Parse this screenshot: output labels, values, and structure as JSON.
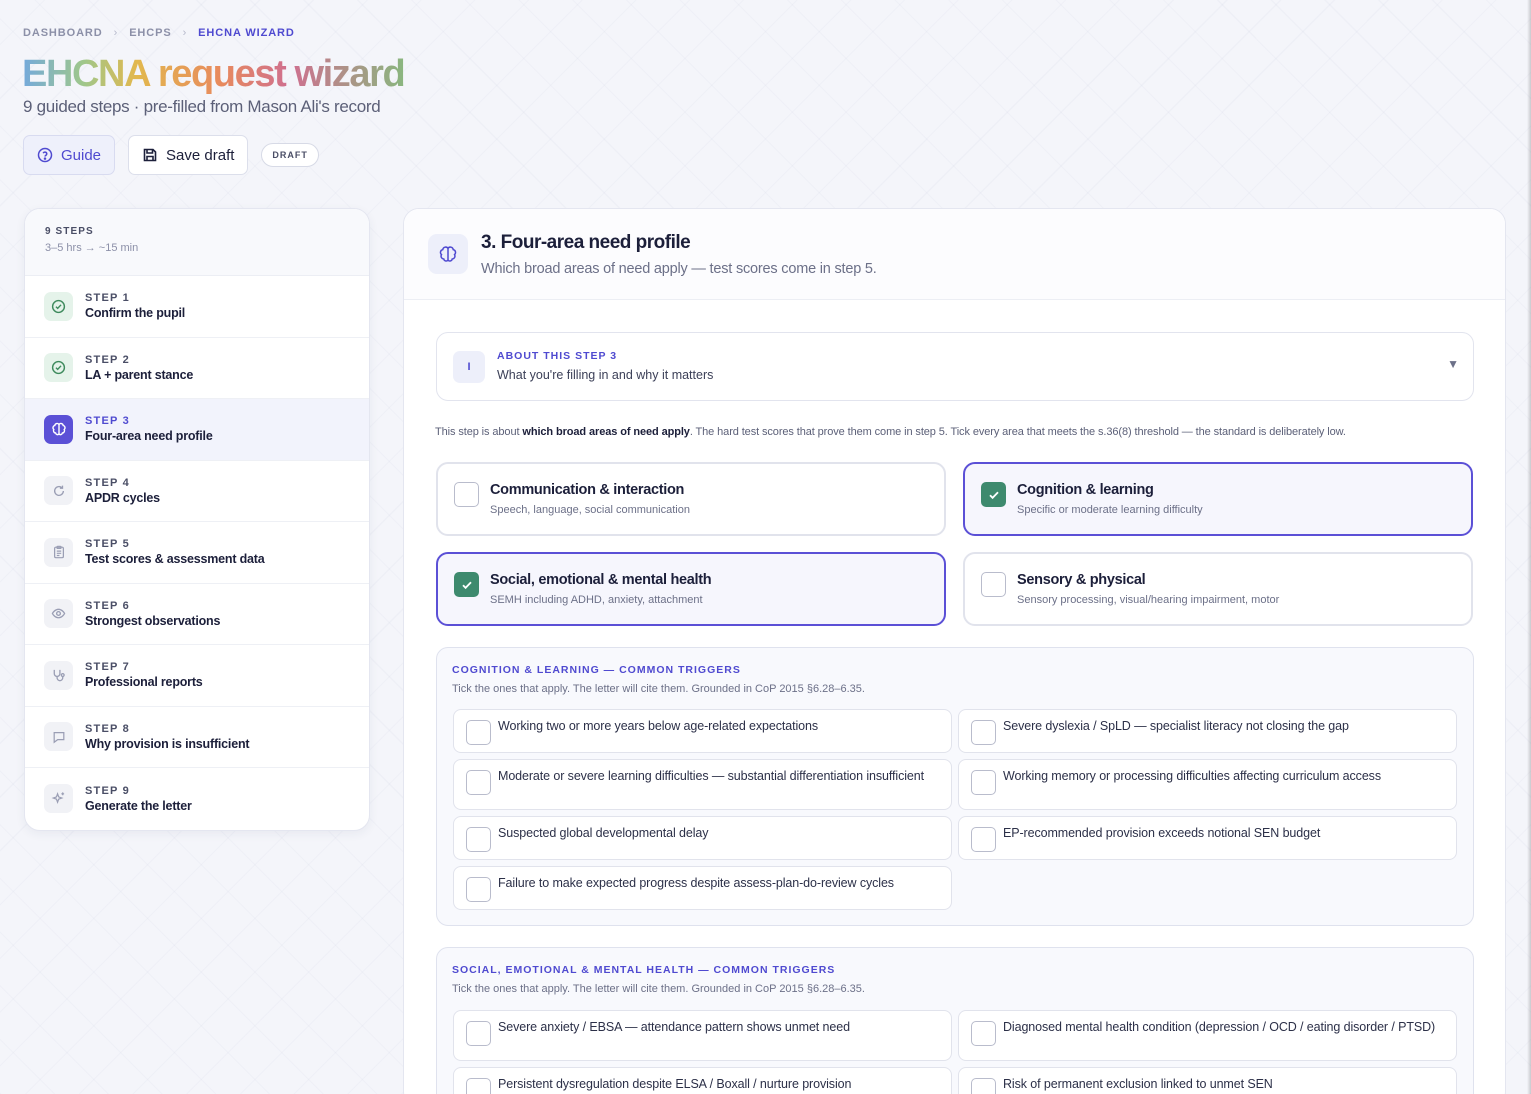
{
  "breadcrumb": [
    "DASHBOARD",
    "EHCPS",
    "EHCNA WIZARD"
  ],
  "header": {
    "title": "EHCNA request wizard",
    "subtitle": "9 guided steps · pre-filled from Mason Ali's record",
    "guide_label": "Guide",
    "save_label": "Save draft",
    "status_badge": "DRAFT"
  },
  "sidebar": {
    "title": "9 STEPS",
    "subtitle": "3–5 hrs → ~15 min",
    "steps": [
      {
        "num": "STEP 1",
        "label": "Confirm the pupil",
        "state": "done",
        "icon": "check-circle-icon"
      },
      {
        "num": "STEP 2",
        "label": "LA + parent stance",
        "state": "done",
        "icon": "check-circle-icon"
      },
      {
        "num": "STEP 3",
        "label": "Four-area need profile",
        "state": "active",
        "icon": "brain-icon"
      },
      {
        "num": "STEP 4",
        "label": "APDR cycles",
        "state": "pending",
        "icon": "refresh-icon"
      },
      {
        "num": "STEP 5",
        "label": "Test scores & assessment data",
        "state": "pending",
        "icon": "clipboard-icon"
      },
      {
        "num": "STEP 6",
        "label": "Strongest observations",
        "state": "pending",
        "icon": "eye-icon"
      },
      {
        "num": "STEP 7",
        "label": "Professional reports",
        "state": "pending",
        "icon": "stethoscope-icon"
      },
      {
        "num": "STEP 8",
        "label": "Why provision is insufficient",
        "state": "pending",
        "icon": "message-icon"
      },
      {
        "num": "STEP 9",
        "label": "Generate the letter",
        "state": "pending",
        "icon": "sparkle-icon"
      }
    ]
  },
  "main": {
    "title": "3. Four-area need profile",
    "subtitle": "Which broad areas of need apply — test scores come in step 5.",
    "about": {
      "icon_letter": "I",
      "title": "ABOUT THIS STEP 3",
      "subtitle": "What you're filling in and why it matters"
    },
    "intro": {
      "before": "This step is about ",
      "bold": "which broad areas of need apply",
      "after": ". The hard test scores that prove them come in step 5. Tick every area that meets the s.36(8) threshold — the standard is deliberately low."
    },
    "areas": [
      {
        "title": "Communication & interaction",
        "desc": "Speech, language, social communication",
        "checked": false
      },
      {
        "title": "Cognition & learning",
        "desc": "Specific or moderate learning difficulty",
        "checked": true
      },
      {
        "title": "Social, emotional & mental health",
        "desc": "SEMH including ADHD, anxiety, attachment",
        "checked": true
      },
      {
        "title": "Sensory & physical",
        "desc": "Sensory processing, visual/hearing impairment, motor",
        "checked": false
      }
    ],
    "trigger_groups": [
      {
        "title": "COGNITION & LEARNING — COMMON TRIGGERS",
        "subtitle": "Tick the ones that apply. The letter will cite them. Grounded in CoP 2015 §6.28–6.35.",
        "items": [
          "Working two or more years below age-related expectations",
          "Severe dyslexia / SpLD — specialist literacy not closing the gap",
          "Moderate or severe learning difficulties — substantial differentiation insufficient",
          "Working memory or processing difficulties affecting curriculum access",
          "Suspected global developmental delay",
          "EP-recommended provision exceeds notional SEN budget",
          "Failure to make expected progress despite assess-plan-do-review cycles"
        ]
      },
      {
        "title": "SOCIAL, EMOTIONAL & MENTAL HEALTH — COMMON TRIGGERS",
        "subtitle": "Tick the ones that apply. The letter will cite them. Grounded in CoP 2015 §6.28–6.35.",
        "items": [
          "Severe anxiety / EBSA — attendance pattern shows unmet need",
          "Diagnosed mental health condition (depression / OCD / eating disorder / PTSD)",
          "Persistent dysregulation despite ELSA / Boxall / nurture provision",
          "Risk of permanent exclusion linked to unmet SEN"
        ]
      }
    ]
  },
  "colors": {
    "accent": "#4f4ad0",
    "check": "#3e8a6e",
    "done": "#3d8a5c"
  }
}
